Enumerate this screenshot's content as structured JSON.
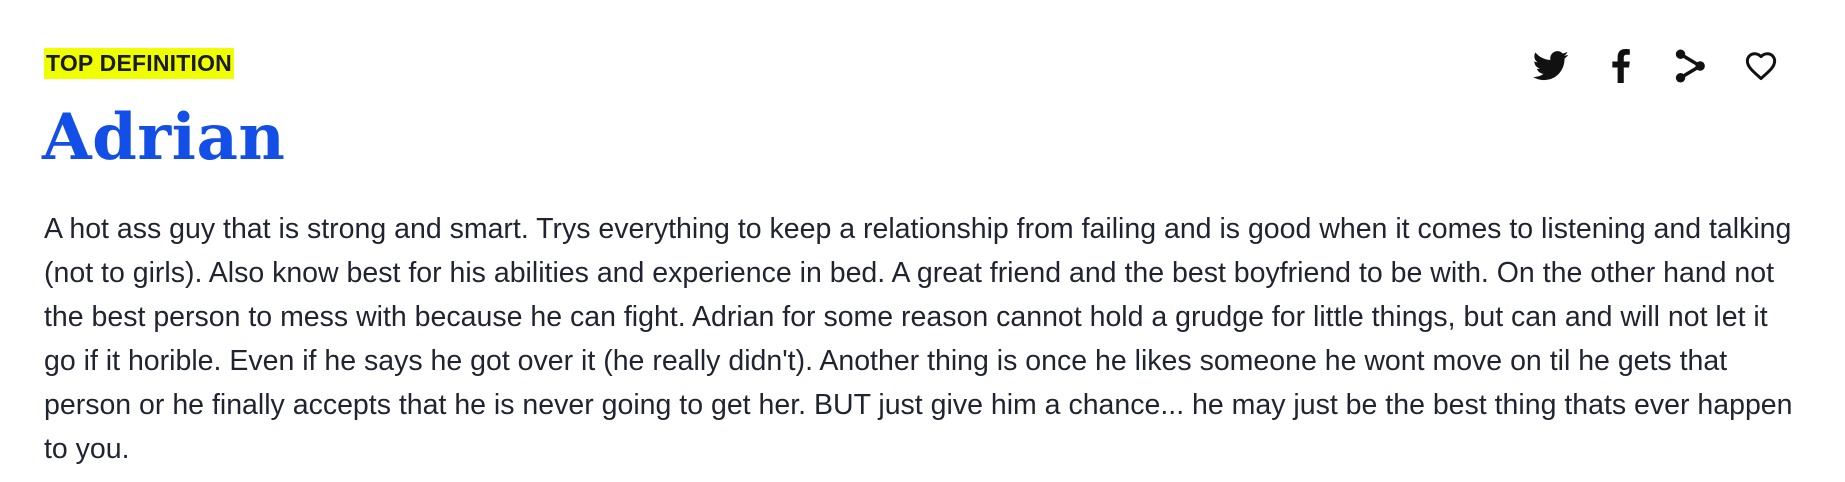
{
  "definition": {
    "badge": "TOP DEFINITION",
    "word": "Adrian",
    "meaning": "A hot ass guy that is strong and smart. Trys everything to keep a relationship from failing and is good when it comes to listening and talking (not to girls). Also know best for his abilities and experience in bed. A great friend and the best boyfriend to be with. On the other hand not the best person to mess with because he can fight. Adrian for some reason cannot hold a grudge for little things, but can and will not let it go if it horible. Even if he says he got over it (he really didn't). Another thing is once he likes someone he wont move on til he gets that person or he finally accepts that he is never going to get her. BUT just give him a chance... he may just be the best thing thats ever happen to you."
  },
  "actions": [
    {
      "icon": "twitter-icon"
    },
    {
      "icon": "facebook-icon"
    },
    {
      "icon": "share-icon"
    },
    {
      "icon": "heart-icon"
    }
  ],
  "colors": {
    "badge_bg": "#efff00",
    "word": "#134fe6",
    "text": "#1f2430",
    "icons": "#111111"
  }
}
